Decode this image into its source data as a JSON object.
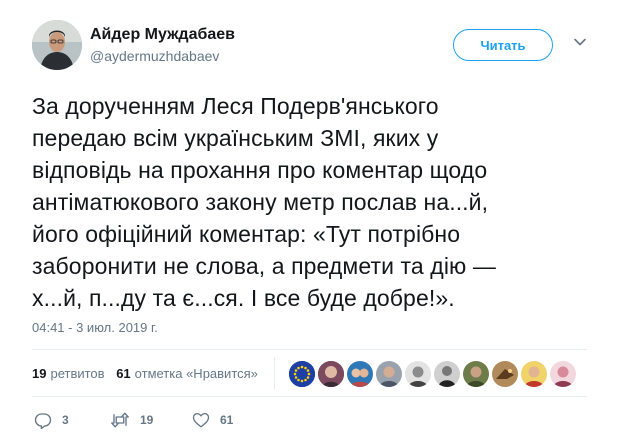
{
  "author": {
    "display_name": "Айдер Муждабаев",
    "handle": "@aydermuzhdabaev"
  },
  "follow_button": {
    "label": "Читать"
  },
  "tweet": {
    "text": "За дорученням Леся Подерв'янського\nпередаю всім українським ЗМІ, яких у\nвідповідь на прохання про коментар щодо\nантіматюкового закону метр послав на...й,\nйого офіційний коментар: «Тут потрібно\nзаборонити не слова, а предмети та дію —\nх...й, п...ду та є...ся.  І все буде добре!».",
    "timestamp": "04:41 - 3 июл. 2019 г."
  },
  "stats": {
    "retweets_count": "19",
    "retweets_label": "ретвитов",
    "likes_count": "61",
    "likes_label": "отметка «Нравится»"
  },
  "likers": [
    "eu-flag",
    "person",
    "person",
    "person",
    "person",
    "person",
    "person",
    "person",
    "person",
    "person",
    "person"
  ],
  "actions": {
    "replies": "3",
    "retweets": "19",
    "likes": "61"
  },
  "colors": {
    "accent": "#1da1f2",
    "text": "#14171a",
    "secondary": "#657786",
    "divider": "#e6ecf0"
  }
}
